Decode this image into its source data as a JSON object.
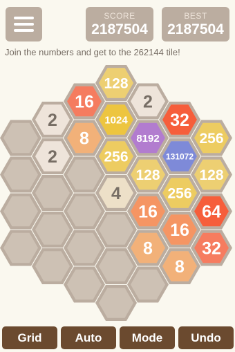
{
  "header": {
    "score_label": "SCORE",
    "score_value": "2187504",
    "best_label": "BEST",
    "best_value": "2187504"
  },
  "tagline": "Join the numbers and get to the 262144 tile!",
  "board": {
    "tiles": [
      {
        "col": 3,
        "row": 1,
        "value": "128",
        "bg": "#edcf72",
        "fg": "#ffffff"
      },
      {
        "col": 4,
        "row": 1.5,
        "value": "2",
        "bg": "#eee4da",
        "fg": "#776e65"
      },
      {
        "col": 2,
        "row": 1.5,
        "value": "16",
        "bg": "#f57c5f",
        "fg": "#ffffff"
      },
      {
        "col": 1,
        "row": 2,
        "value": "2",
        "bg": "#eee4da",
        "fg": "#776e65"
      },
      {
        "col": 3,
        "row": 2,
        "value": "1024",
        "bg": "#edc53f",
        "fg": "#ffffff"
      },
      {
        "col": 5,
        "row": 2,
        "value": "32",
        "bg": "#f65e3b",
        "fg": "#ffffff"
      },
      {
        "col": 2,
        "row": 2.5,
        "value": "8",
        "bg": "#f2b179",
        "fg": "#ffffff"
      },
      {
        "col": 4,
        "row": 2.5,
        "value": "8192",
        "bg": "#b27ccf",
        "fg": "#ffffff"
      },
      {
        "col": 6,
        "row": 2.5,
        "value": "256",
        "bg": "#edcc61",
        "fg": "#ffffff"
      },
      {
        "col": 1,
        "row": 3,
        "value": "2",
        "bg": "#eee4da",
        "fg": "#776e65"
      },
      {
        "col": 3,
        "row": 3,
        "value": "256",
        "bg": "#edcc61",
        "fg": "#ffffff"
      },
      {
        "col": 5,
        "row": 3,
        "value": "131072",
        "bg": "#7e8ad8",
        "fg": "#ffffff"
      },
      {
        "col": 4,
        "row": 3.5,
        "value": "128",
        "bg": "#edcf72",
        "fg": "#ffffff"
      },
      {
        "col": 6,
        "row": 3.5,
        "value": "128",
        "bg": "#edcf72",
        "fg": "#ffffff"
      },
      {
        "col": 3,
        "row": 4,
        "value": "4",
        "bg": "#ede0c8",
        "fg": "#776e65"
      },
      {
        "col": 5,
        "row": 4,
        "value": "256",
        "bg": "#edcc61",
        "fg": "#ffffff"
      },
      {
        "col": 4,
        "row": 4.5,
        "value": "16",
        "bg": "#f59563",
        "fg": "#ffffff"
      },
      {
        "col": 6,
        "row": 4.5,
        "value": "64",
        "bg": "#f65e3b",
        "fg": "#ffffff"
      },
      {
        "col": 5,
        "row": 5,
        "value": "16",
        "bg": "#f59563",
        "fg": "#ffffff"
      },
      {
        "col": 4,
        "row": 5.5,
        "value": "8",
        "bg": "#f2b179",
        "fg": "#ffffff"
      },
      {
        "col": 6,
        "row": 5.5,
        "value": "32",
        "bg": "#f67c5f",
        "fg": "#ffffff"
      },
      {
        "col": 5,
        "row": 6,
        "value": "8",
        "bg": "#f2b179",
        "fg": "#ffffff"
      }
    ]
  },
  "buttons": {
    "grid": "Grid",
    "auto": "Auto",
    "mode": "Mode",
    "undo": "Undo"
  },
  "colors": {
    "background": "#faf8ef",
    "board": "#bbada0",
    "empty_cell": "#cdc1b4",
    "button": "#6b4a2f"
  }
}
